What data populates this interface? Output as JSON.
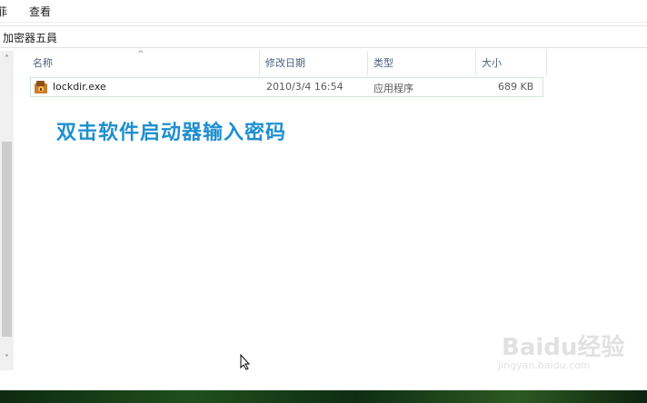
{
  "menu": {
    "edit_fragment": "菲",
    "view": "查看"
  },
  "address": {
    "path": "加密器五員"
  },
  "columns": {
    "name": "名称",
    "modified": "修改日期",
    "type": "类型",
    "size": "大小"
  },
  "files": [
    {
      "name": "lockdir.exe",
      "modified": "2010/3/4 16:54",
      "type": "应用程序",
      "size": "689 KB"
    }
  ],
  "caption": "双击软件启动器输入密码",
  "watermark": {
    "logo": "Baidu经验",
    "url": "jingyan.baidu.com"
  },
  "colors": {
    "caption": "#1d8fd1",
    "header_text": "#4d6082"
  },
  "icons": {
    "file": "exe-package-icon",
    "scroll_up": "chevron-up-icon",
    "scroll_down": "chevron-down-icon",
    "cursor": "mouse-pointer-icon"
  }
}
